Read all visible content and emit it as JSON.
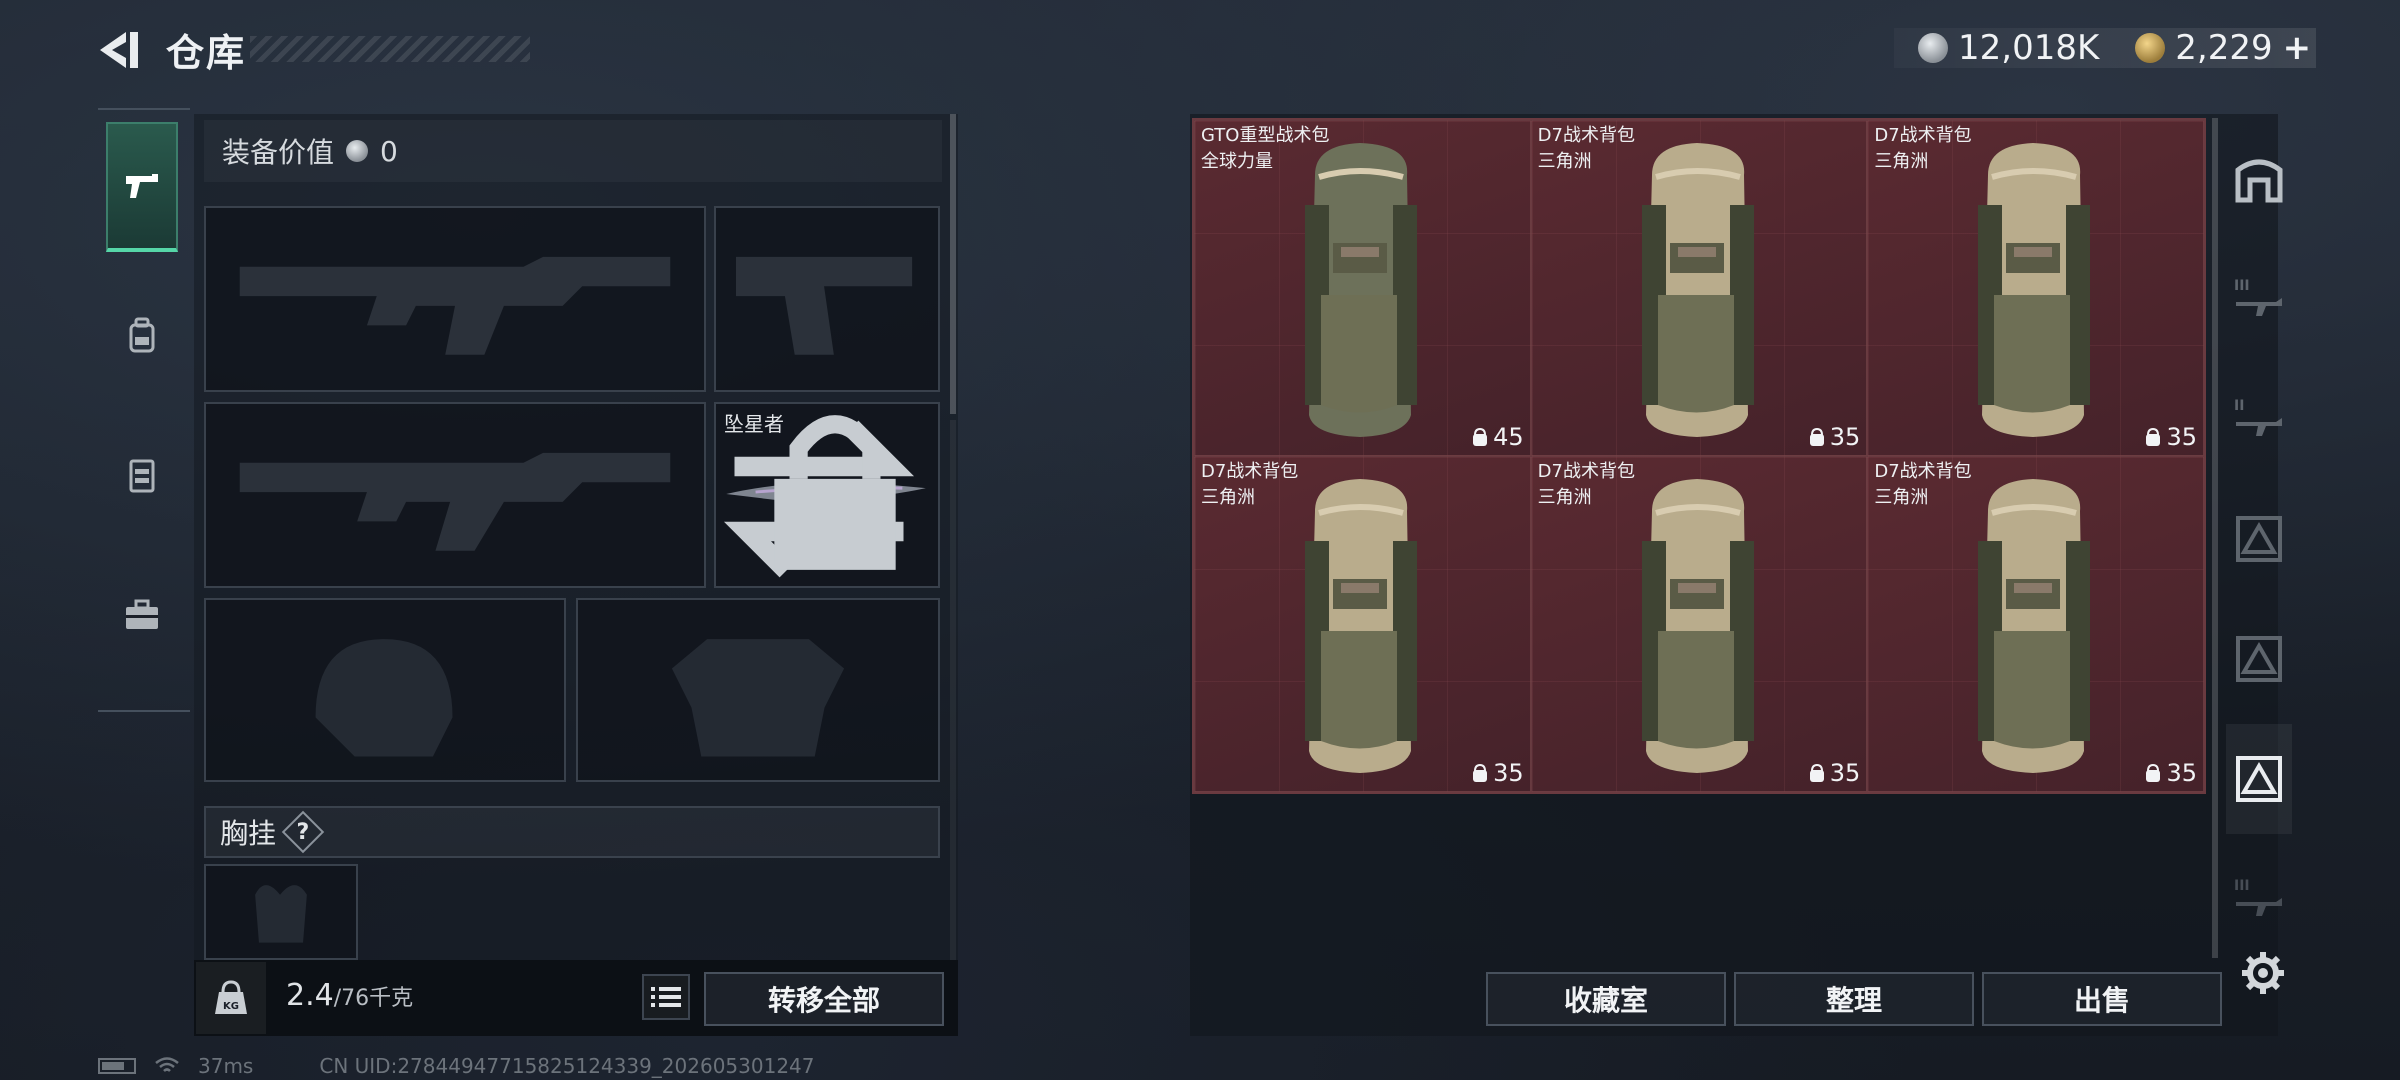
{
  "header": {
    "title": "仓库",
    "currency_silver": "12,018K",
    "currency_gold": "2,229",
    "plus": "+"
  },
  "left_tabs": [
    "weapons",
    "backpack",
    "chest-rig",
    "case"
  ],
  "loadout": {
    "equip_value_label": "装备价值",
    "equip_value": "0",
    "melee_name": "坠星者",
    "chest_rig_label": "胸挂",
    "help": "?"
  },
  "weight": {
    "current": "2.4",
    "max": "/76千克"
  },
  "buttons": {
    "transfer_all": "转移全部",
    "collection_room": "收藏室",
    "sort": "整理",
    "sell": "出售"
  },
  "inventory": {
    "items": [
      {
        "name": "GTO重型战术包",
        "source": "全球力量",
        "count": "45"
      },
      {
        "name": "D7战术背包",
        "source": "三角洲",
        "count": "35"
      },
      {
        "name": "D7战术背包",
        "source": "三角洲",
        "count": "35"
      },
      {
        "name": "D7战术背包",
        "source": "三角洲",
        "count": "35"
      },
      {
        "name": "D7战术背包",
        "source": "三角洲",
        "count": "35"
      },
      {
        "name": "D7战术背包",
        "source": "三角洲",
        "count": "35"
      }
    ]
  },
  "status": {
    "ping": "37ms",
    "uid": "CN UID:278449477158251243​39_202605301247"
  },
  "colors": {
    "accent_green": "#56d6a8",
    "cell_red": "#4a2329"
  }
}
